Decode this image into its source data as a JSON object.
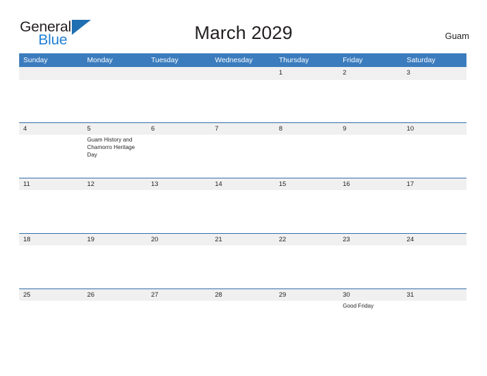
{
  "brand": {
    "name_part1": "General",
    "name_part2": "Blue",
    "triangle_color": "#1f6fb2",
    "blue_text_color": "#1f7fd4"
  },
  "header": {
    "title": "March 2029",
    "locale": "Guam"
  },
  "theme": {
    "header_blue": "#3b7cbe",
    "row_rule_blue": "#2f6ca8",
    "date_strip_gray": "#f0f0f0",
    "text_color": "#231f20"
  },
  "calendar": {
    "weekdays": [
      "Sunday",
      "Monday",
      "Tuesday",
      "Wednesday",
      "Thursday",
      "Friday",
      "Saturday"
    ],
    "weeks": [
      [
        {
          "date": "",
          "event": ""
        },
        {
          "date": "",
          "event": ""
        },
        {
          "date": "",
          "event": ""
        },
        {
          "date": "",
          "event": ""
        },
        {
          "date": "1",
          "event": ""
        },
        {
          "date": "2",
          "event": ""
        },
        {
          "date": "3",
          "event": ""
        }
      ],
      [
        {
          "date": "4",
          "event": ""
        },
        {
          "date": "5",
          "event": "Guam History and Chamorro Heritage Day"
        },
        {
          "date": "6",
          "event": ""
        },
        {
          "date": "7",
          "event": ""
        },
        {
          "date": "8",
          "event": ""
        },
        {
          "date": "9",
          "event": ""
        },
        {
          "date": "10",
          "event": ""
        }
      ],
      [
        {
          "date": "11",
          "event": ""
        },
        {
          "date": "12",
          "event": ""
        },
        {
          "date": "13",
          "event": ""
        },
        {
          "date": "14",
          "event": ""
        },
        {
          "date": "15",
          "event": ""
        },
        {
          "date": "16",
          "event": ""
        },
        {
          "date": "17",
          "event": ""
        }
      ],
      [
        {
          "date": "18",
          "event": ""
        },
        {
          "date": "19",
          "event": ""
        },
        {
          "date": "20",
          "event": ""
        },
        {
          "date": "21",
          "event": ""
        },
        {
          "date": "22",
          "event": ""
        },
        {
          "date": "23",
          "event": ""
        },
        {
          "date": "24",
          "event": ""
        }
      ],
      [
        {
          "date": "25",
          "event": ""
        },
        {
          "date": "26",
          "event": ""
        },
        {
          "date": "27",
          "event": ""
        },
        {
          "date": "28",
          "event": ""
        },
        {
          "date": "29",
          "event": ""
        },
        {
          "date": "30",
          "event": "Good Friday"
        },
        {
          "date": "31",
          "event": ""
        }
      ]
    ]
  }
}
